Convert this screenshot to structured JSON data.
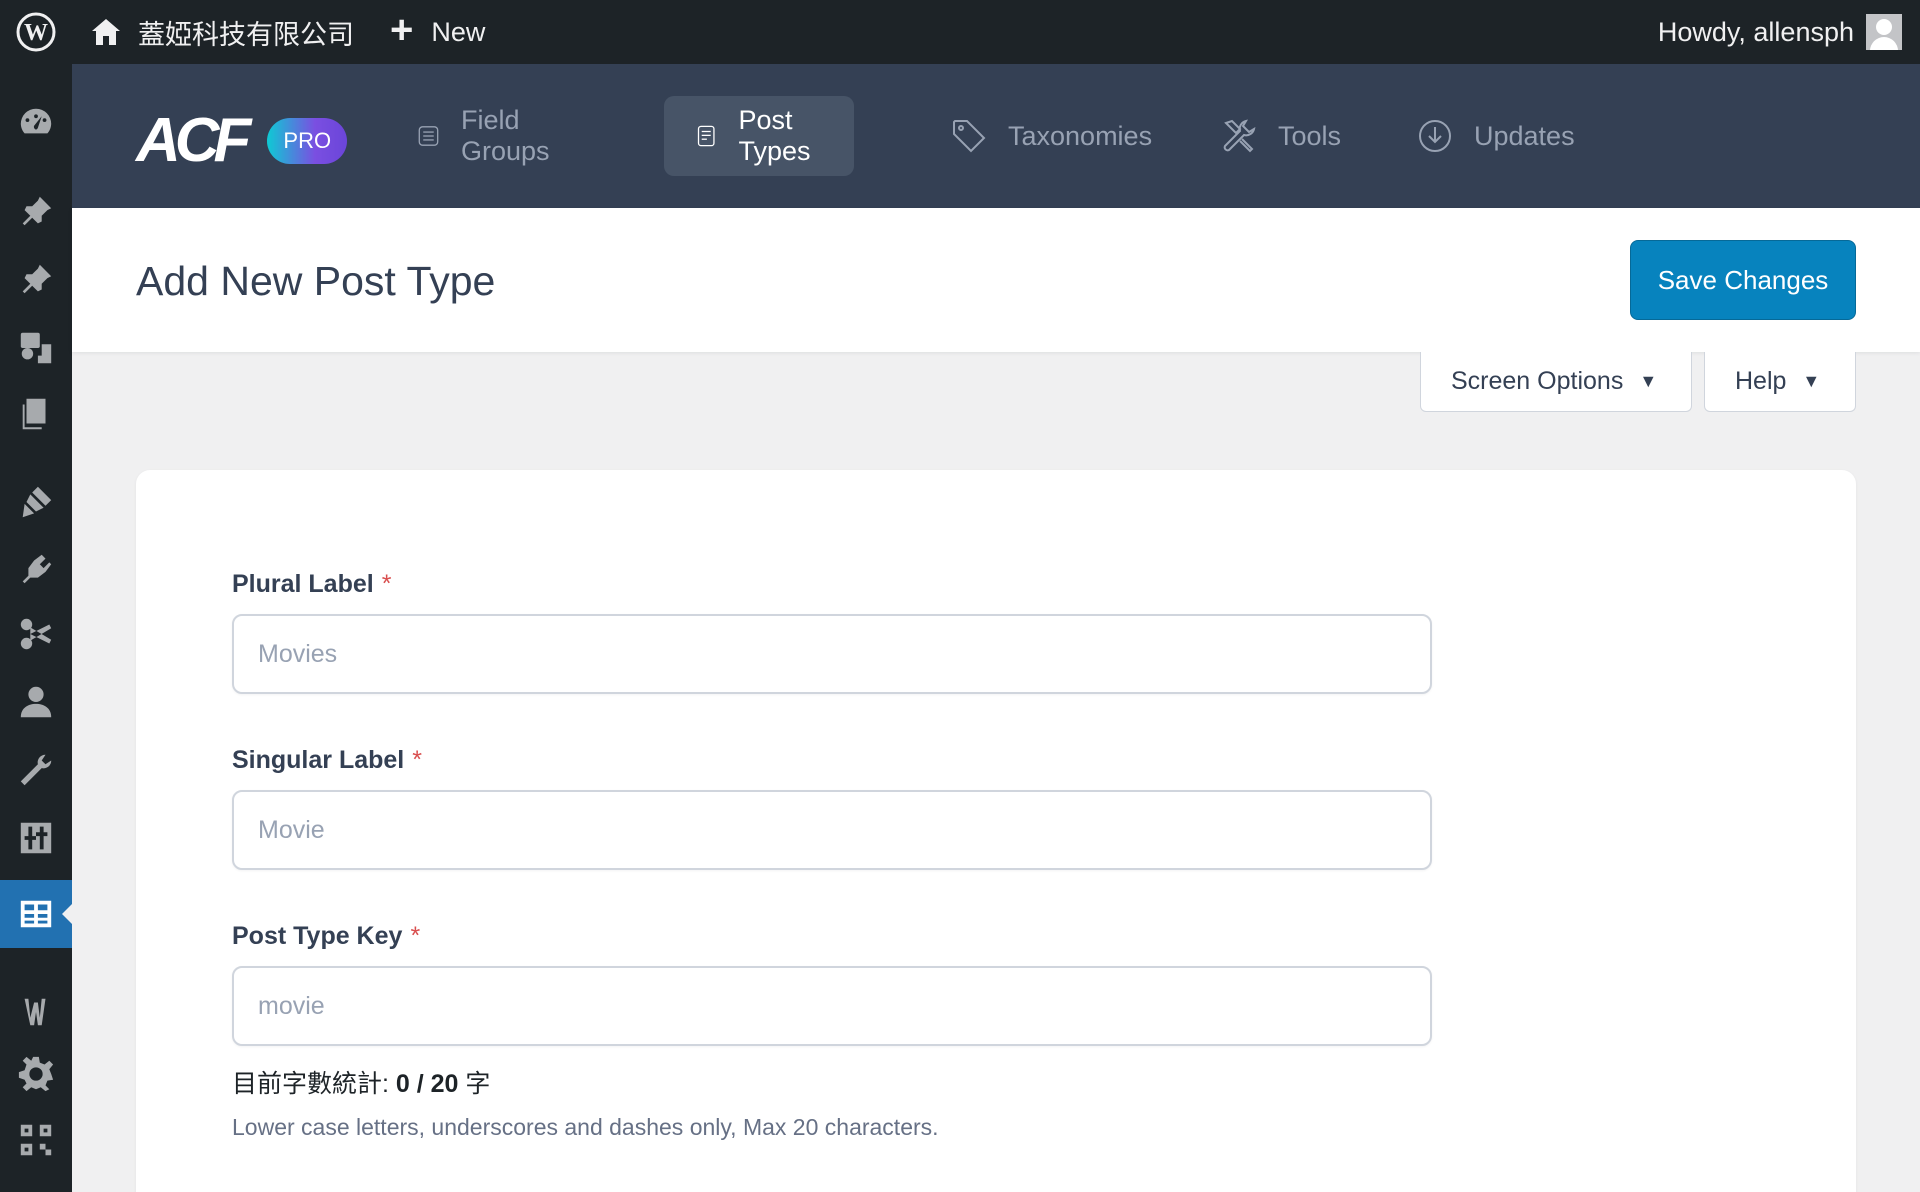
{
  "admin_bar": {
    "site_name": "蓋婭科技有限公司",
    "new_label": "New",
    "howdy": "Howdy, allensph",
    "icons": [
      "wordpress-logo-icon",
      "home-icon",
      "plus-icon",
      "avatar"
    ]
  },
  "sidebar": {
    "items": [
      {
        "icon": "dashboard-icon"
      },
      {
        "icon": "pin-icon"
      },
      {
        "icon": "pin-icon"
      },
      {
        "icon": "media-icon"
      },
      {
        "icon": "pages-icon"
      },
      {
        "icon": "appearance-icon"
      },
      {
        "icon": "plugins-icon"
      },
      {
        "icon": "scissors-icon"
      },
      {
        "icon": "users-icon"
      },
      {
        "icon": "tools-icon"
      },
      {
        "icon": "settings-sliders-icon"
      },
      {
        "icon": "acf-fields-icon",
        "current": true
      },
      {
        "icon": "plugin-w-icon"
      },
      {
        "icon": "gear-icon"
      },
      {
        "icon": "qr-code-icon"
      }
    ]
  },
  "acf_header": {
    "logo_text": "ACF",
    "badge": "PRO",
    "tabs": [
      {
        "label": "Field Groups",
        "icon": "list-icon",
        "active": false
      },
      {
        "label": "Post Types",
        "icon": "document-icon",
        "active": true
      },
      {
        "label": "Taxonomies",
        "icon": "tag-icon",
        "active": false
      },
      {
        "label": "Tools",
        "icon": "tools-icon",
        "active": false
      },
      {
        "label": "Updates",
        "icon": "download-icon",
        "active": false
      }
    ]
  },
  "page": {
    "title": "Add New Post Type",
    "save_label": "Save Changes",
    "screen_options": "Screen Options",
    "help": "Help"
  },
  "form": {
    "plural": {
      "label": "Plural Label",
      "required": "*",
      "placeholder": "Movies",
      "value": ""
    },
    "singular": {
      "label": "Singular Label",
      "required": "*",
      "placeholder": "Movie",
      "value": ""
    },
    "key": {
      "label": "Post Type Key",
      "required": "*",
      "placeholder": "movie",
      "value": ""
    },
    "char_count_prefix": "目前字數統計: ",
    "char_count_value": "0 / 20",
    "char_count_suffix": " 字",
    "hint": "Lower case letters, underscores and dashes only, Max 20 characters."
  },
  "colors": {
    "admin_bar": "#1d2327",
    "acf_header": "#344054",
    "active_tab": "#475467",
    "primary_button": "#0783be",
    "sidebar_current": "#2271b1",
    "required_star": "#d94f4f"
  }
}
